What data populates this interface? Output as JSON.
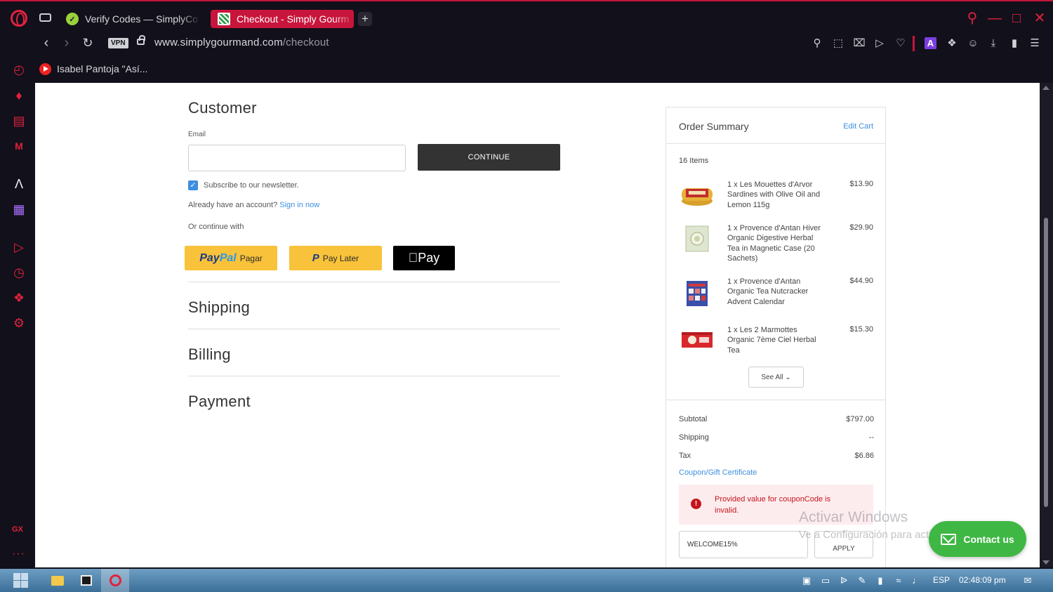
{
  "browser": {
    "tabs": [
      {
        "title": "Verify Codes — SimplyCo",
        "active": false
      },
      {
        "title": "Checkout - Simply Gourm",
        "active": true
      }
    ],
    "new_tab_label": "+",
    "vpn_label": "VPN",
    "url_domain": "www.simplygourmand.com",
    "url_path": "/checkout",
    "bookmark": "Isabel Pantoja \"Así...",
    "accent_color": "#e0223f",
    "sidebar_gx_label": "GX",
    "sidebar_more_label": "···"
  },
  "checkout": {
    "customer_heading": "Customer",
    "email_label": "Email",
    "email_value": "",
    "continue_label": "CONTINUE",
    "newsletter_label": "Subscribe to our newsletter.",
    "newsletter_checked": true,
    "account_prompt": "Already have an account?",
    "sign_in_link": "Sign in now",
    "continue_with": "Or continue with",
    "paypal": {
      "pay": "Pay",
      "pal": "Pal",
      "sub": "Pagar"
    },
    "paylater": {
      "p": "P",
      "label": "Pay Later"
    },
    "applepay": {
      "label": "Pay"
    },
    "shipping_heading": "Shipping",
    "billing_heading": "Billing",
    "payment_heading": "Payment"
  },
  "summary": {
    "title": "Order Summary",
    "edit_cart": "Edit Cart",
    "items_count": "16 Items",
    "items": [
      {
        "name": "1 x Les Mouettes d'Arvor Sardines with Olive Oil and Lemon 115g",
        "price": "$13.90"
      },
      {
        "name": "1 x Provence d'Antan Hiver Organic Digestive Herbal Tea in Magnetic Case (20 Sachets)",
        "price": "$29.90"
      },
      {
        "name": "1 x Provence d'Antan Organic Tea Nutcracker Advent Calendar",
        "price": "$44.90"
      },
      {
        "name": "1 x Les 2 Marmottes Organic 7ème Ciel Herbal Tea",
        "price": "$15.30"
      }
    ],
    "see_all": "See All",
    "subtotal_label": "Subtotal",
    "subtotal_value": "$797.00",
    "shipping_label": "Shipping",
    "shipping_value": "--",
    "tax_label": "Tax",
    "tax_value": "$6.86",
    "coupon_link": "Coupon/Gift Certificate",
    "error_text": "Provided value for couponCode is invalid.",
    "coupon_value": "WELCOME15%",
    "apply_label": "APPLY"
  },
  "overlay": {
    "watermark_title": "Activar Windows",
    "watermark_sub": "Ve a Configuración para activar Windows.",
    "contact_label": "Contact us"
  },
  "taskbar": {
    "language": "ESP",
    "time": "02:48:09 pm"
  }
}
